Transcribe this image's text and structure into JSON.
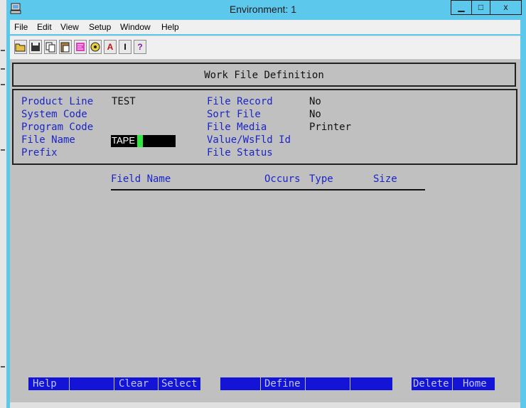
{
  "window": {
    "title": "Environment: 1",
    "controls": {
      "minimize": "▁",
      "maximize": "□",
      "close": "x"
    }
  },
  "menu": [
    "File",
    "Edit",
    "View",
    "Setup",
    "Window",
    "Help"
  ],
  "toolbar": {
    "buttons": [
      {
        "icon": "open-folder-icon"
      },
      {
        "icon": "save-icon"
      },
      {
        "icon": "copy-icon"
      },
      {
        "icon": "paste-icon"
      },
      {
        "icon": "macro-icon"
      },
      {
        "icon": "keymap-icon"
      },
      {
        "icon": "font-icon",
        "glyph": "A"
      },
      {
        "icon": "cursor-icon",
        "glyph": "I"
      },
      {
        "icon": "help-icon",
        "glyph": "?"
      }
    ]
  },
  "screen": {
    "title": "Work File Definition",
    "left_fields": [
      {
        "label": "Product Line",
        "value": "TEST"
      },
      {
        "label": "System Code",
        "value": ""
      },
      {
        "label": "Program Code",
        "value": ""
      },
      {
        "label": "File Name",
        "value": "TAPE"
      },
      {
        "label": "Prefix",
        "value": ""
      }
    ],
    "right_fields": [
      {
        "label": "File Record",
        "value": "No"
      },
      {
        "label": "Sort File",
        "value": "No"
      },
      {
        "label": "File Media",
        "value": "Printer"
      },
      {
        "label": "Value/WsFld Id",
        "value": ""
      },
      {
        "label": "File Status",
        "value": ""
      }
    ],
    "columns": {
      "field_name": "Field Name",
      "occurs": "Occurs",
      "type": "Type",
      "size": "Size"
    }
  },
  "function_keys": [
    "Help",
    "",
    "Clear",
    "Select",
    "",
    "Define",
    "",
    "",
    "Delete",
    "Home"
  ],
  "colors": {
    "titlebar": "#5bc8ec",
    "screen_bg": "#c0c0c0",
    "label_blue": "#1a25c8",
    "fkey_blue": "#1414d6",
    "cursor_green": "#2ee83e"
  }
}
